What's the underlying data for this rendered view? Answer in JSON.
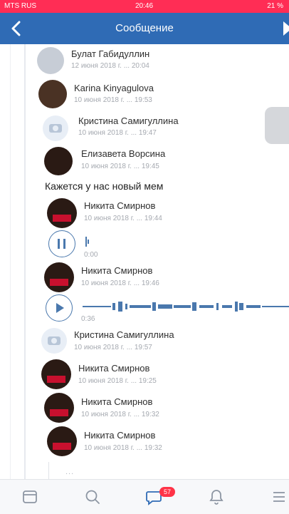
{
  "status_bar": {
    "carrier": "MTS RUS",
    "time": "20:46",
    "battery": "21 %"
  },
  "nav": {
    "title": "Сообщение",
    "back_icon": "chevron-left-icon"
  },
  "messages": [
    {
      "name": "Булат Габидуллин",
      "date": "12 июня 2018 г. ... 20:04"
    },
    {
      "name": "Karina Kinyagulova",
      "date": "10 июня 2018 г. ... 19:53"
    },
    {
      "name": "Кристина Самигуллина",
      "date": "10 июня 2018 г. ... 19:47"
    },
    {
      "name": "Елизавета Ворсина",
      "date": "10 июня 2018 г. ... 19:45"
    },
    {
      "name": "Никита Смирнов",
      "date": "10 июня 2018 г. ... 19:44"
    },
    {
      "name": "Никита Смирнов",
      "date": "10 июня 2018 г. ... 19:46"
    },
    {
      "name": "Кристина Самигуллина",
      "date": "10 июня 2018 г. ... 19:57"
    },
    {
      "name": "Никита Смирнов",
      "date": "10 июня 2018 г. ... 19:25"
    },
    {
      "name": "Никита Смирнов",
      "date": "10 июня 2018 г. ... 19:32"
    },
    {
      "name": "Никита Смирнов",
      "date": "10 июня 2018 г. ... 19:32"
    }
  ],
  "text_message": "Кажется у нас новый мем",
  "audio": [
    {
      "state": "paused",
      "time": "0:00"
    },
    {
      "state": "stopped",
      "time": "0:36"
    }
  ],
  "typing_text": "...",
  "tabs": {
    "items": [
      "news-icon",
      "search-icon",
      "messages-icon",
      "notifications-icon",
      "menu-icon"
    ],
    "badge": "57"
  },
  "colors": {
    "nav": "#2f6bb5",
    "status": "#ff2d55",
    "accent": "#4a78ad",
    "badge": "#ff3347"
  }
}
